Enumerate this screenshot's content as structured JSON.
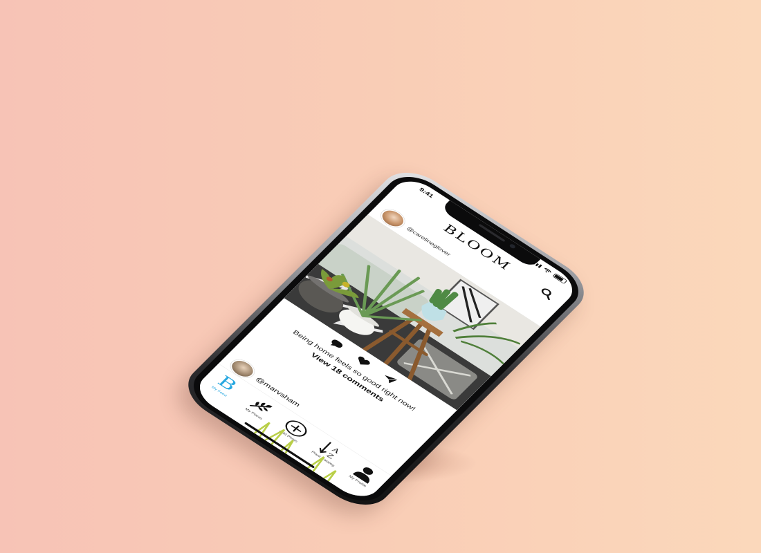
{
  "status_bar": {
    "time": "9:41"
  },
  "app": {
    "title": "BLOOM"
  },
  "post": {
    "username": "@carolineglover",
    "caption": "Being home feels so good right now!",
    "comments_link": "View 18 comments"
  },
  "next_post": {
    "username": "@marvsham"
  },
  "tab_bar": {
    "items": [
      {
        "label": "My Feed",
        "icon": "bloom-b-icon",
        "active": true
      },
      {
        "label": "My Plants",
        "icon": "leaf-branch-icon",
        "active": false
      },
      {
        "label": "Add Photo",
        "icon": "plus-circle-icon",
        "active": false
      },
      {
        "label": "Plant Catalog",
        "icon": "sort-az-icon",
        "active": false
      },
      {
        "label": "My Profile",
        "icon": "person-icon",
        "active": false
      }
    ]
  },
  "colors": {
    "background_left": "#f7c3b6",
    "background_right": "#fbd8bb",
    "accent": "#29a8e0"
  }
}
